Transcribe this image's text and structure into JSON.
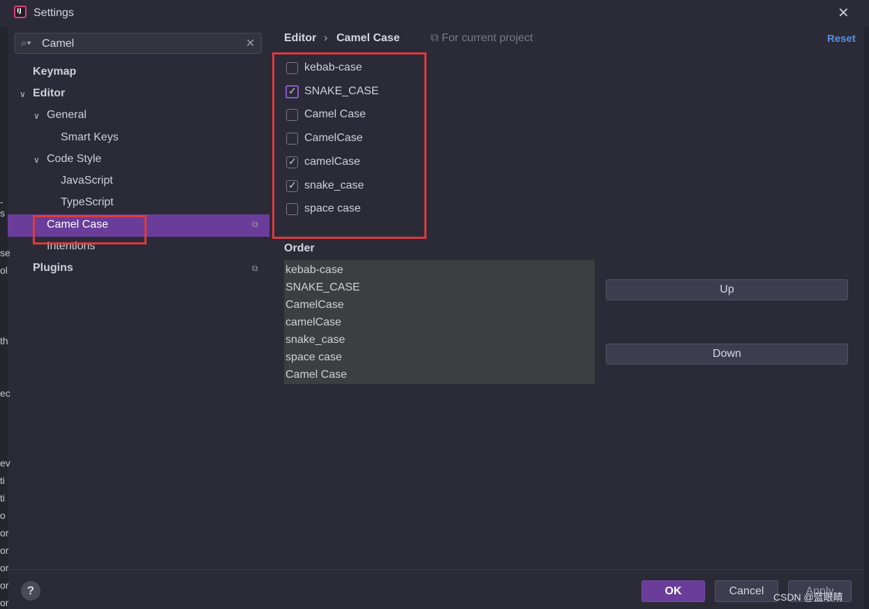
{
  "window": {
    "title": "Settings",
    "app_icon_text": "IJ"
  },
  "search": {
    "value": "Camel"
  },
  "tree": {
    "keymap": "Keymap",
    "editor": "Editor",
    "general": "General",
    "smart_keys": "Smart Keys",
    "code_style": "Code Style",
    "javascript": "JavaScript",
    "typescript": "TypeScript",
    "camel_case": "Camel Case",
    "intentions": "Intentions",
    "plugins": "Plugins"
  },
  "breadcrumb": {
    "parent": "Editor",
    "current": "Camel Case",
    "scope": "For current project"
  },
  "reset_label": "Reset",
  "options": [
    {
      "label": "kebab-case",
      "checked": false
    },
    {
      "label": "SNAKE_CASE",
      "checked": true
    },
    {
      "label": "Camel Case",
      "checked": false
    },
    {
      "label": "CamelCase",
      "checked": false
    },
    {
      "label": "camelCase",
      "checked": true
    },
    {
      "label": "snake_case",
      "checked": true
    },
    {
      "label": "space case",
      "checked": false
    }
  ],
  "order": {
    "label": "Order",
    "items": [
      "kebab-case",
      "SNAKE_CASE",
      "CamelCase",
      "camelCase",
      "snake_case",
      "space case",
      "Camel Case"
    ]
  },
  "buttons": {
    "up": "Up",
    "down": "Down",
    "ok": "OK",
    "cancel": "Cancel",
    "apply": "Apply",
    "help": "?"
  },
  "left_edge_fragments": [
    "-s",
    "se",
    "ol",
    "th",
    "ec",
    "ev",
    "ti",
    "ti",
    "o",
    "or",
    "or",
    "or",
    "or",
    "or"
  ],
  "watermark": "CSDN @蓝眼睛",
  "colors": {
    "accent": "#6a3d9a",
    "highlight_box": "#e03a3a",
    "link": "#5a8fe0"
  }
}
